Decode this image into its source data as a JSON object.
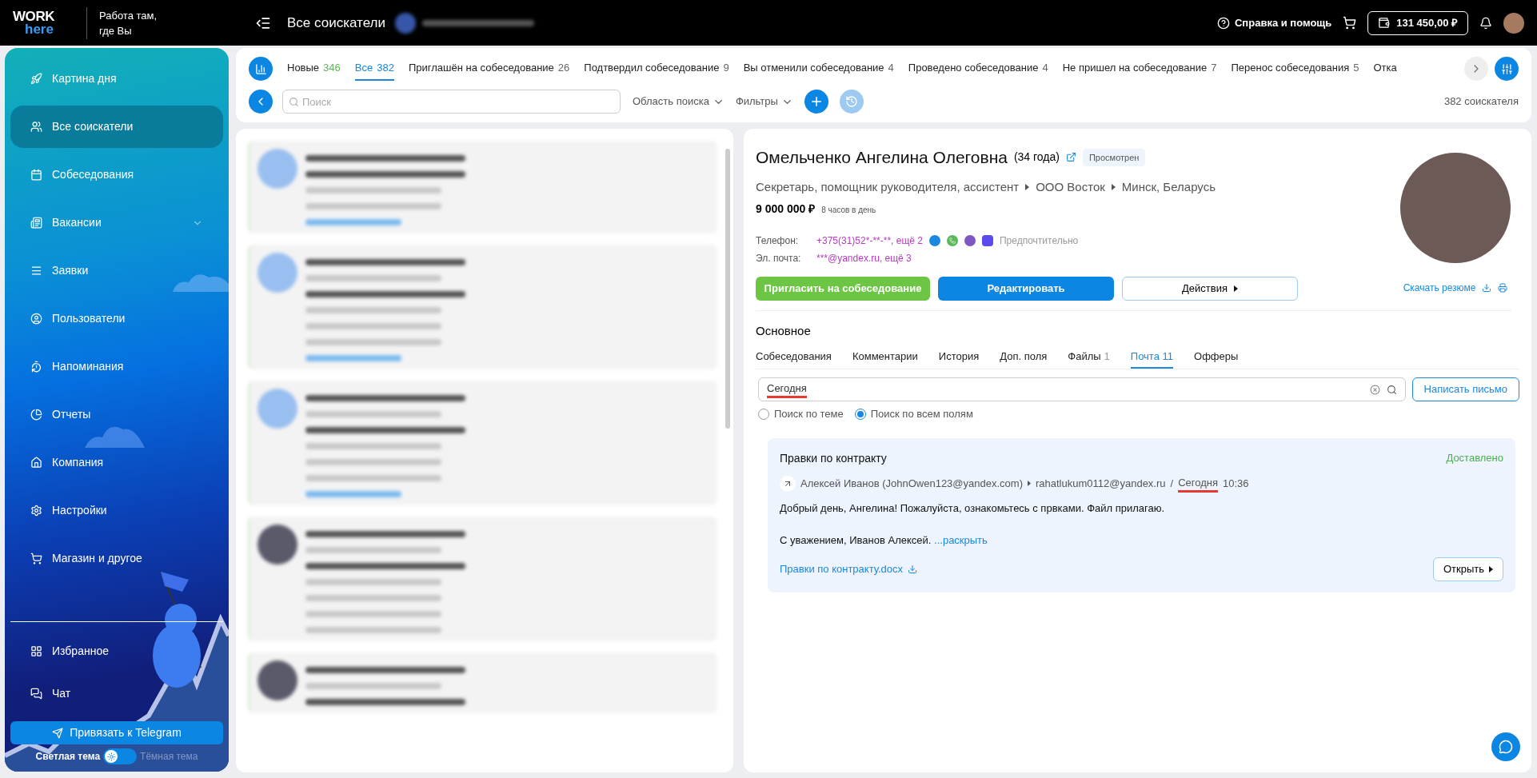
{
  "header": {
    "logo_top": "WORK",
    "logo_bottom": "here",
    "tagline": "Работа там,\nгде Вы",
    "page_title": "Все соискатели",
    "help": "Справка и помощь",
    "balance": "131 450,00 ₽"
  },
  "sidebar": {
    "items": [
      {
        "label": "Картина дня",
        "selected": false,
        "expandable": false
      },
      {
        "label": "Все соискатели",
        "selected": true,
        "expandable": false
      },
      {
        "label": "Собеседования",
        "selected": false,
        "expandable": false
      },
      {
        "label": "Вакансии",
        "selected": false,
        "expandable": true
      },
      {
        "label": "Заявки",
        "selected": false,
        "expandable": false
      },
      {
        "label": "Пользователи",
        "selected": false,
        "expandable": false
      },
      {
        "label": "Напоминания",
        "selected": false,
        "expandable": false
      },
      {
        "label": "Отчеты",
        "selected": false,
        "expandable": false
      },
      {
        "label": "Компания",
        "selected": false,
        "expandable": false
      },
      {
        "label": "Настройки",
        "selected": false,
        "expandable": false
      },
      {
        "label": "Магазин и другое",
        "selected": false,
        "expandable": false
      }
    ],
    "bottom_items": [
      {
        "label": "Избранное",
        "selected": false
      },
      {
        "label": "Чат",
        "selected": false
      }
    ],
    "telegram_button": "Привязать к Telegram",
    "theme": {
      "light_label": "Светлая тема",
      "dark_label": "Тёмная тема",
      "dark": false
    }
  },
  "tabs": [
    {
      "label": "Новые",
      "count": "346",
      "color": "#5cb85c",
      "selected": false
    },
    {
      "label": "Все",
      "count": "382",
      "color": "#1a88e0",
      "selected": true
    },
    {
      "label": "Приглашён на собеседование",
      "count": "26",
      "color": "#666666",
      "selected": false
    },
    {
      "label": "Подтвердил собеседование",
      "count": "9",
      "color": "#666666",
      "selected": false
    },
    {
      "label": "Вы отменили собеседование",
      "count": "4",
      "color": "#666666",
      "selected": false
    },
    {
      "label": "Проведено собеседование",
      "count": "4",
      "color": "#666666",
      "selected": false
    },
    {
      "label": "Не пришел на собеседование",
      "count": "7",
      "color": "#666666",
      "selected": false
    },
    {
      "label": "Перенос собеседования",
      "count": "5",
      "color": "#666666",
      "selected": false
    },
    {
      "label": "Отка",
      "selected": false
    }
  ],
  "toolbar": {
    "search_placeholder": "Поиск",
    "scope": "Область поиска",
    "filters": "Фильтры",
    "total": "382 соискателя"
  },
  "profile": {
    "name": "Омельченко Ангелина Олеговна",
    "age": "(34 года)",
    "status": "Просмотрен",
    "path": [
      "Секретарь, помощник руководителя, ассистент",
      "ООО Восток",
      "Минск, Беларусь"
    ],
    "salary": "9 000 000 ₽",
    "schedule": "8 часов в день",
    "phone_label": "Телефон:",
    "phone": "+375(31)52*-**-**, ещё 2",
    "preferred": "Предпочтительно",
    "email_label": "Эл. почта:",
    "email": "***@yandex.ru, ещё 3",
    "invite_button": "Пригласить на собеседование",
    "edit_button": "Редактировать",
    "actions_button": "Действия",
    "download": "Скачать резюме"
  },
  "section_title": "Основное",
  "detail_tabs": [
    {
      "label": "Собеседования",
      "selected": false
    },
    {
      "label": "Комментарии",
      "selected": false
    },
    {
      "label": "История",
      "selected": false
    },
    {
      "label": "Доп. поля",
      "selected": false
    },
    {
      "label": "Файлы",
      "count": "1",
      "selected": false
    },
    {
      "label": "Почта 11",
      "selected": true
    },
    {
      "label": "Офферы",
      "selected": false
    }
  ],
  "mail_search": {
    "value": "Сегодня",
    "marked": true,
    "write_button": "Написать письмо",
    "options": [
      {
        "label": "Поиск по теме",
        "selected": false
      },
      {
        "label": "Поиск по всем полям",
        "selected": true
      }
    ]
  },
  "messages": [
    {
      "subject": "Правки по контракту",
      "status": "Доставлено",
      "from": "Алексей Иванов (JohnOwen123@yandex.com)",
      "to": "rahatlukum0112@yandex.ru",
      "separator": "/",
      "date": "Сегодня",
      "date_marked": true,
      "time": "10:36",
      "body": [
        "Добрый день, Ангелина! Пожалуйста, ознакомьтесь с првками. Файл прилагаю.",
        "С уважением, Иванов Алексей."
      ],
      "expand": "...раскрыть",
      "attachment": "Правки по контракту.docx",
      "open_button": "Открыть"
    }
  ]
}
